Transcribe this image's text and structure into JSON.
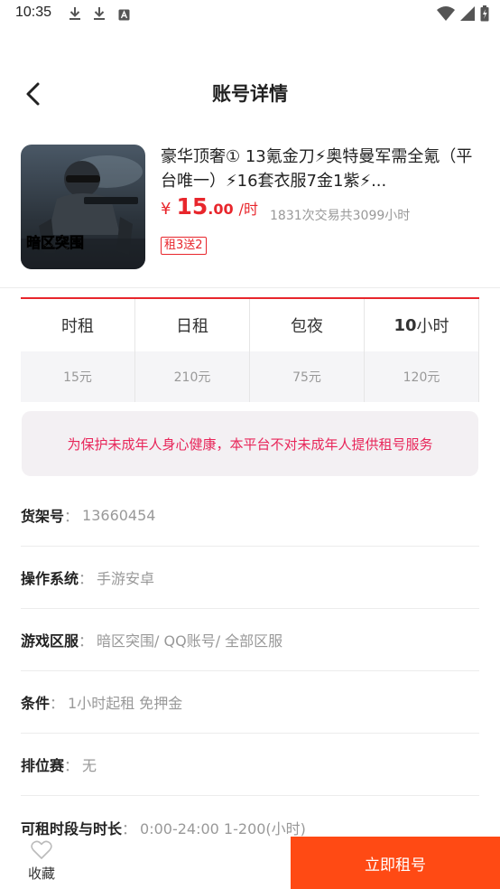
{
  "status_bar": {
    "time": "10:35"
  },
  "header": {
    "title": "账号详情"
  },
  "product": {
    "title": "豪华顶奢① 13氪金刀⚡奥特曼军需全氪（平台唯一）⚡16套衣服7金1紫⚡...",
    "thumb_text": "暗区突围",
    "price_currency": "¥",
    "price_integer": "15",
    "price_decimal": ".00",
    "price_unit": "/时",
    "trade_stats": "1831次交易共3099小时",
    "promo_tag": "租3送2"
  },
  "rent_options": [
    {
      "label": "时租",
      "price": "15元"
    },
    {
      "label": "日租",
      "price": "210元"
    },
    {
      "label": "包夜",
      "price": "75元"
    },
    {
      "label_num": "10",
      "label_text": "小时",
      "price": "120元"
    }
  ],
  "notice": "为保护未成年人身心健康，本平台不对未成年人提供租号服务",
  "info_rows": [
    {
      "label": "货架号",
      "value": "13660454"
    },
    {
      "label": "操作系统",
      "value": "手游安卓"
    },
    {
      "label": "游戏区服",
      "value": "暗区突围/ QQ账号/ 全部区服"
    },
    {
      "label": "条件",
      "value": "1小时起租 免押金"
    },
    {
      "label": "排位赛",
      "value": "无"
    },
    {
      "label": "可租时段与时长",
      "value": "0:00-24:00 1-200(小时)"
    }
  ],
  "colon": "：",
  "bottom_bar": {
    "favorite_label": "收藏",
    "rent_now_label": "立即租号"
  },
  "colors": {
    "accent_red": "#e8262c",
    "rent_button": "#ff4a14",
    "notice_text": "#e8265a"
  },
  "icons": [
    "download-icon",
    "download-icon",
    "keyboard-icon",
    "wifi-icon",
    "signal-icon",
    "battery-icon",
    "back-arrow-icon",
    "heart-outline-icon"
  ]
}
